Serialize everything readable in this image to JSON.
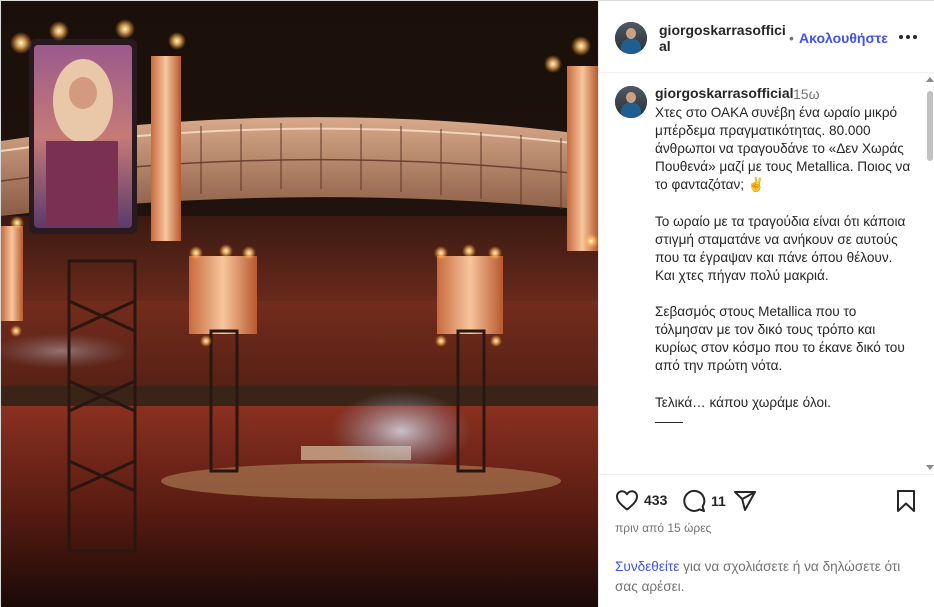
{
  "post": {
    "username": "giorgoskarrasofficial",
    "follow_separator": "•",
    "follow_label": "Ακολουθήστε",
    "more_icon": "more-horizontal-icon",
    "time_ago": "15ω",
    "caption": [
      "Χτες στο ΟΑΚΑ συνέβη ένα ωραίο μικρό μπέρδεμα πραγματικότητας. 80.000 άνθρωποι να τραγουδάνε το «Δεν Χωράς Πουθενά» μαζί με τους Metallica. Ποιος να το φανταζόταν; ✌️",
      "Το ωραίο με τα τραγούδια είναι ότι κάποια στιγμή σταματάνε να ανήκουν σε αυτούς που τα έγραψαν και πάνε όπου θέλουν. Και χτες πήγαν πολύ μακριά.",
      "Σεβασμός στους Metallica που το τόλμησαν με τον δικό τους τρόπο και κυρίως στον κόσμο που το έκανε δικό του από την πρώτη νότα.",
      "Τελικά… κάπου χωράμε όλοι."
    ],
    "likes": "433",
    "comments": "11",
    "posted_ago": "πριν από 15 ώρες",
    "login_link": "Συνδεθείτε",
    "login_text": " για να σχολιάσετε ή να δηλώσετε ότι σας αρέσει."
  },
  "colors": {
    "link": "#4150f7",
    "muted": "#737373",
    "text": "#262626"
  }
}
